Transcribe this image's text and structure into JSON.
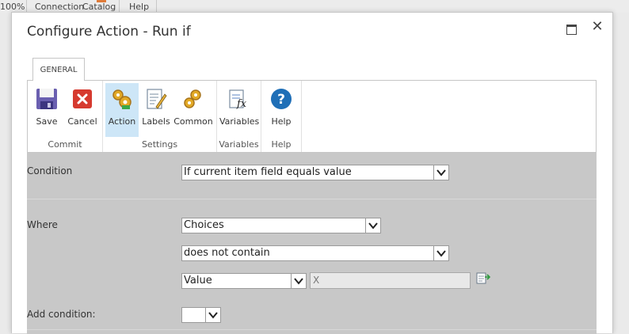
{
  "background_menu": {
    "zoom": "100%",
    "items": [
      "Connection",
      "Catalog",
      "Help"
    ]
  },
  "dialog": {
    "title": "Configure Action - Run if"
  },
  "ribbon": {
    "tab": "GENERAL",
    "groups": {
      "commit": {
        "label": "Commit",
        "save": "Save",
        "cancel": "Cancel"
      },
      "settings": {
        "label": "Settings",
        "action": "Action",
        "labels": "Labels",
        "common": "Common"
      },
      "variables": {
        "label": "Variables",
        "variables": "Variables"
      },
      "help": {
        "label": "Help",
        "help": "Help"
      }
    }
  },
  "form": {
    "condition": {
      "label": "Condition",
      "value": "If current item field equals value"
    },
    "where": {
      "label": "Where",
      "field": "Choices",
      "operator": "does not contain",
      "value_type": "Value",
      "value_input": "X"
    },
    "add_condition": {
      "label": "Add condition:",
      "value": ""
    }
  },
  "colors": {
    "active_button": "#cde6f7",
    "form_background": "#c8c8c8",
    "cancel_red": "#d63a2f",
    "help_blue": "#1f6fb7"
  }
}
